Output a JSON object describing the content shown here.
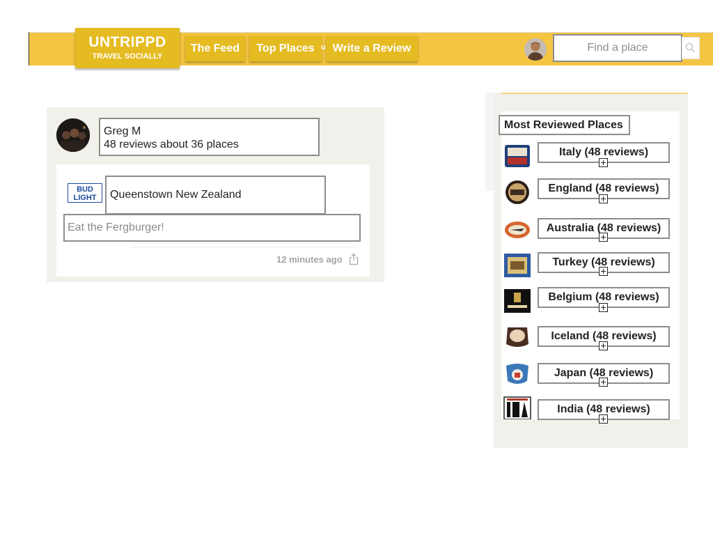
{
  "header": {
    "logo_title": "UNTRIPPD",
    "logo_subtitle": "TRAVEL SOCIALLY",
    "nav": {
      "feed": "The Feed",
      "top_places": "Top Places",
      "write_review": "Write a Review"
    },
    "search_placeholder": "Find a place",
    "icons": {
      "avatar": "user-avatar",
      "search": "search-icon"
    }
  },
  "feed": {
    "user": {
      "name": "Greg M",
      "stats": "48 reviews about 36 places"
    },
    "review": {
      "logo_text_line1": "BUD",
      "logo_text_line2": "LIGHT",
      "place": "Queenstown New Zealand",
      "text_placeholder": "Eat the Fergburger!",
      "time": "12 minutes ago",
      "share_icon": "share-icon"
    }
  },
  "sidebar": {
    "title": "Most Reviewed Places",
    "places": [
      {
        "label": "Italy (48 reviews)"
      },
      {
        "label": "England (48 reviews)"
      },
      {
        "label": "Australia (48 reviews)"
      },
      {
        "label": "Turkey (48 reviews)"
      },
      {
        "label": "Belgium (48 reviews)"
      },
      {
        "label": "Iceland (48 reviews)"
      },
      {
        "label": "Japan (48 reviews)"
      },
      {
        "label": "India (48 reviews)"
      }
    ]
  },
  "colors": {
    "topbar": "#f4c542",
    "button": "#e5bb22",
    "panel": "#f2f0ea",
    "border": "#8c8c8c"
  }
}
